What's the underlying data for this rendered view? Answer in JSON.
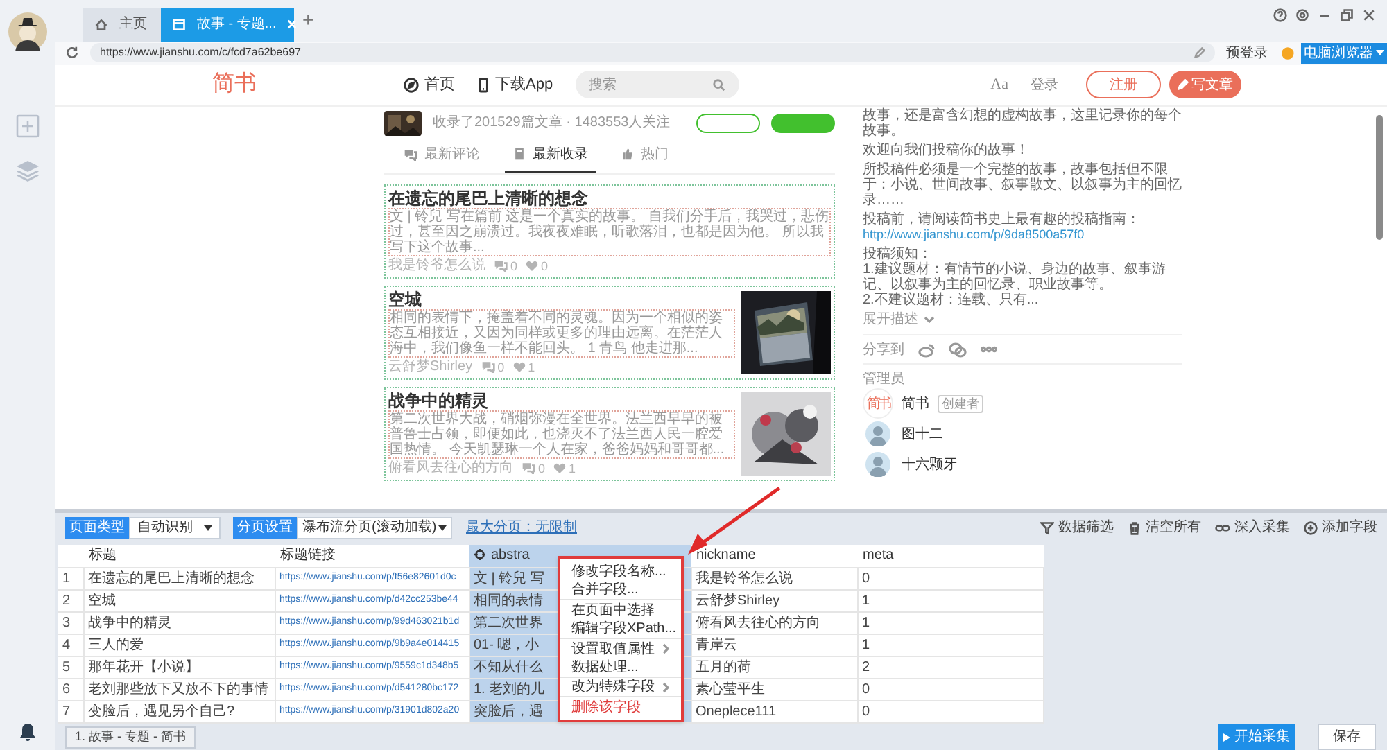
{
  "browser": {
    "tabs": [
      {
        "label": "主页",
        "kind": "home",
        "selected": false
      },
      {
        "label": "故事 - 专题...",
        "kind": "page",
        "selected": true
      }
    ],
    "new_tab": "+",
    "url": "https://www.jianshu.com/c/fcd7a62be697",
    "pre_login": "预登录",
    "mode_button": "电脑浏览器"
  },
  "site_header": {
    "logo": "简书",
    "nav": [
      {
        "label": "首页"
      },
      {
        "label": "下载App"
      }
    ],
    "search_placeholder": "搜索",
    "font_toggle": "Aa",
    "login": "登录",
    "register": "注册",
    "write": "写文章"
  },
  "collection": {
    "stats": "收录了201529篇文章 · 1483553人关注"
  },
  "feed_tabs": [
    {
      "label": "最新评论",
      "selected": false
    },
    {
      "label": "最新收录",
      "selected": true
    },
    {
      "label": "热门",
      "selected": false
    }
  ],
  "articles": [
    {
      "title": "在遗忘的尾巴上清晰的想念",
      "abstract": "文 | 铃兒 写在篇前 这是一个真实的故事。 自我们分手后，我哭过，悲伤过，甚至因之崩溃过。我夜夜难眠，听歌落泪，也都是因为他。 所以我写下这个故事...",
      "author": "我是铃爷怎么说",
      "comments": "0",
      "likes": "0",
      "has_image": false
    },
    {
      "title": "空城",
      "abstract": "相同的表情下，掩盖着不同的灵魂。因为一个相似的姿态互相接近，又因为同样或更多的理由远离。在茫茫人海中，我们像鱼一样不能回头。 1 青鸟 他走进那...",
      "author": "云舒梦Shirley",
      "comments": "0",
      "likes": "1",
      "has_image": true
    },
    {
      "title": "战争中的精灵",
      "abstract": "第二次世界大战，硝烟弥漫在全世界。法兰西早早的被普鲁士占领，即便如此，也浇灭不了法兰西人民一腔爱国热情。 今天凯瑟琳一个人在家，爸爸妈妈和哥哥都...",
      "author": "俯看风去往心的方向",
      "comments": "0",
      "likes": "1",
      "has_image": true
    }
  ],
  "sidebar": {
    "paragraphs": [
      "故事，还是富含幻想的虚构故事，这里记录你的每个故事。",
      "欢迎向我们投稿你的故事！",
      "所投稿件必须是一个完整的故事，故事包括但不限于：小说、世间故事、叙事散文、以叙事为主的回忆录……"
    ],
    "guide": {
      "text": "投稿前，请阅读简书史上最有趣的投稿指南：",
      "link": "http://www.jianshu.com/p/9da8500a57f0"
    },
    "notice": [
      "投稿须知：",
      "1.建议题材：有情节的小说、身边的故事、叙事游记、以叙事为主的回忆录、职业故事等。",
      "2.不建议题材：连载、只有..."
    ],
    "expand": "展开描述",
    "share_label": "分享到",
    "admins_title": "管理员",
    "admins": [
      {
        "name": "简书",
        "kind": "logo",
        "avatar_text": "简书",
        "badge": "创建者"
      },
      {
        "name": "图十二",
        "kind": "person"
      },
      {
        "name": "十六颗牙",
        "kind": "person"
      }
    ]
  },
  "extractor": {
    "toolbar": {
      "page_type_label": "页面类型",
      "page_type": "自动识别",
      "paging_label": "分页设置",
      "paging": "瀑布流分页(滚动加载)",
      "max_pages": "最大分页：无限制",
      "actions": [
        "数据筛选",
        "清空所有",
        "深入采集",
        "添加字段"
      ]
    },
    "table": {
      "columns": [
        {
          "label": "标题",
          "selected": false
        },
        {
          "label": "标题链接",
          "selected": false
        },
        {
          "label": "abstra",
          "selected": true
        },
        {
          "label": "nickname",
          "selected": false
        },
        {
          "label": "meta",
          "selected": false
        }
      ],
      "rows": [
        {
          "index": "1",
          "title": "在遗忘的尾巴上清晰的想念",
          "url": "https://www.jianshu.com/p/f56e82601d0c",
          "abstract": "文 | 铃兒 写",
          "nickname": "我是铃爷怎么说",
          "meta": "0"
        },
        {
          "index": "2",
          "title": "空城",
          "url": "https://www.jianshu.com/p/d42cc253be44",
          "abstract": "相同的表情",
          "nickname": "云舒梦Shirley",
          "meta": "1"
        },
        {
          "index": "3",
          "title": "战争中的精灵",
          "url": "https://www.jianshu.com/p/99d463021b1d",
          "abstract": "第二次世界",
          "nickname": "俯看风去往心的方向",
          "meta": "1"
        },
        {
          "index": "4",
          "title": "三人的爱",
          "url": "https://www.jianshu.com/p/9b9a4e014415",
          "abstract": "01- 嗯，小",
          "nickname": "青岸云",
          "meta": "1"
        },
        {
          "index": "5",
          "title": "那年花开【小说】",
          "url": "https://www.jianshu.com/p/9559c1d348b5",
          "abstract": "不知从什么",
          "nickname": "五月的荷",
          "meta": "2"
        },
        {
          "index": "6",
          "title": "老刘那些放下又放不下的事情",
          "url": "https://www.jianshu.com/p/d541280bc172",
          "abstract": "1. 老刘的儿",
          "nickname": "素心莹平生",
          "meta": "0"
        },
        {
          "index": "7",
          "title": "变脸后，遇见另个自己?",
          "url": "https://www.jianshu.com/p/31901d802a20",
          "abstract": "突脸后，遇",
          "nickname": "Oneplece111",
          "meta": "0"
        }
      ]
    },
    "context_menu": [
      {
        "label": "修改字段名称...",
        "kind": "normal",
        "submenu": false,
        "divider_after": false
      },
      {
        "label": "合并字段...",
        "kind": "normal",
        "submenu": false,
        "divider_after": true
      },
      {
        "label": "在页面中选择",
        "kind": "normal",
        "submenu": false,
        "divider_after": false
      },
      {
        "label": "编辑字段XPath...",
        "kind": "normal",
        "submenu": false,
        "divider_after": true
      },
      {
        "label": "设置取值属性",
        "kind": "normal",
        "submenu": true,
        "divider_after": false
      },
      {
        "label": "数据处理...",
        "kind": "normal",
        "submenu": false,
        "divider_after": true
      },
      {
        "label": "改为特殊字段",
        "kind": "normal",
        "submenu": true,
        "divider_after": true
      },
      {
        "label": "删除该字段",
        "kind": "danger",
        "submenu": false,
        "divider_after": false
      }
    ],
    "task_tabs": [
      "1. 故事 - 专题 - 简书"
    ],
    "start_button": "开始采集",
    "save_button": "保存"
  }
}
